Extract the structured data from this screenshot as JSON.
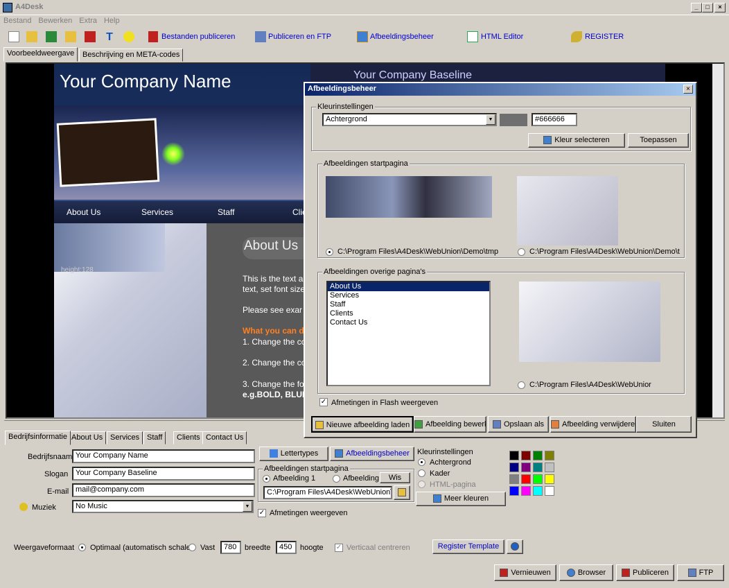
{
  "app": {
    "title": "A4Desk"
  },
  "menu": [
    "Bestand",
    "Bewerken",
    "Extra",
    "Help"
  ],
  "toolbar": {
    "publish_files": "Bestanden publiceren",
    "publish_ftp": "Publiceren en FTP",
    "image_manager": "Afbeeldingsbeheer",
    "html_editor": "HTML Editor",
    "register": "REGISTER"
  },
  "top_tabs": [
    "Voorbeeldweergave",
    "Beschrijving en META-codes"
  ],
  "preview": {
    "company": "Your Company Name",
    "baseline": "Your Company Baseline",
    "nav": [
      "About Us",
      "Services",
      "Staff",
      "Clie"
    ],
    "heading": "About Us",
    "height_label": "height:128",
    "body": [
      "This is the text ar",
      "text, set font size",
      "Please see exar",
      "What you can de",
      "1. Change the co",
      "2. Change the co",
      "3. Change the fo",
      "e.g.BOLD, BLUE"
    ]
  },
  "dialog": {
    "title": "Afbeeldingsbeheer",
    "color_group": "Kleurinstellingen",
    "color_target": "Achtergrond",
    "color_hex": "#666666",
    "color_swatch": "#6f6f6f",
    "pick_color": "Kleur selecteren",
    "apply": "Toepassen",
    "start_group": "Afbeeldingen startpagina",
    "start_path1": "C:\\Program Files\\A4Desk\\WebUnion\\Demo\\tmp",
    "start_path2": "C:\\Program Files\\A4Desk\\WebUnion\\Demo\\t",
    "other_group": "Afbeeldingen overige pagina's",
    "pages": [
      "About Us",
      "Services",
      "Staff",
      "Clients",
      "Contact Us"
    ],
    "other_path": "C:\\Program Files\\A4Desk\\WebUnior",
    "flash_sizes": "Afmetingen in Flash weergeven",
    "buttons": [
      "Nieuwe afbeelding laden",
      "Afbeelding bewerk",
      "Opslaan als",
      "Afbeelding verwijderen",
      "Sluiten"
    ]
  },
  "bottom_tabs": [
    "Bedrijfsinformatie",
    "About Us",
    "Services",
    "Staff",
    "Clients",
    "Contact Us"
  ],
  "form": {
    "company_label": "Bedrijfsnaam",
    "company": "Your Company Name",
    "slogan_label": "Slogan",
    "slogan": "Your Company Baseline",
    "email_label": "E-mail",
    "email": "mail@company.com",
    "music_label": "Muziek",
    "music": "No Music",
    "fonts_btn": "Lettertypes",
    "images_btn": "Afbeeldingsbeheer",
    "start_images": "Afbeeldingen startpagina",
    "img1": "Afbeelding 1",
    "img2": "Afbeelding",
    "wis": "Wis",
    "img_path": "C:\\Program Files\\A4Desk\\WebUnion\\",
    "show_sizes": "Afmetingen weergeven",
    "color_group": "Kleurinstellingen",
    "opt_bg": "Achtergrond",
    "opt_frame": "Kader",
    "opt_html": "HTML-pagina",
    "more_colors": "Meer kleuren",
    "format_label": "Weergaveformaat",
    "format_opt": "Optimaal (automatisch schaler",
    "fixed": "Vast",
    "width_val": "780",
    "width_lbl": "breedte",
    "height_val": "450",
    "height_lbl": "hoogte",
    "center": "Verticaal centreren",
    "register_template": "Register Template"
  },
  "palette": [
    "#000000",
    "#800000",
    "#008000",
    "#808000",
    "#000080",
    "#800080",
    "#008080",
    "#c0c0c0",
    "#808080",
    "#ff0000",
    "#00ff00",
    "#ffff00",
    "#0000ff",
    "#ff00ff",
    "#00ffff",
    "#ffffff"
  ],
  "footer": [
    "Vernieuwen",
    "Browser",
    "Publiceren",
    "FTP"
  ]
}
